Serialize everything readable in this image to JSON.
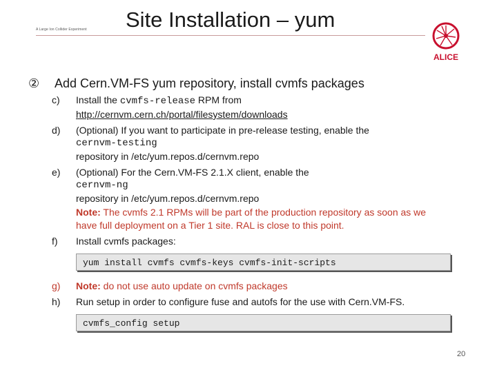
{
  "header": {
    "title": "Site Installation – yum",
    "logo_caption": "A Large Ion Collider Experiment",
    "logo_text": "ALICE"
  },
  "section": {
    "number": "②",
    "title": "Add Cern.VM-FS yum repository, install cvmfs packages"
  },
  "items": {
    "c": {
      "letter": "c)",
      "text_pre": "Install the ",
      "code": "cvmfs-release",
      "text_post": " RPM from",
      "link": "http://cernvm.cern.ch/portal/filesystem/downloads"
    },
    "d": {
      "letter": "d)",
      "line1": "(Optional) If you want to participate in pre-release testing, enable the",
      "code": "cernvm-testing",
      "line3": "repository in /etc/yum.repos.d/cernvm.repo"
    },
    "e": {
      "letter": "e)",
      "line1": "(Optional) For the Cern.VM-FS 2.1.X client, enable the",
      "code": "cernvm-ng",
      "line3": "repository in /etc/yum.repos.d/cernvm.repo",
      "note_label": "Note:",
      "note_line1": " The cvmfs 2.1 RPMs will be part of the production repository as soon as we",
      "note_line2": "have full deployment on a Tier 1 site.  RAL is close to this point."
    },
    "f": {
      "letter": "f)",
      "text": "Install cvmfs packages:",
      "command": "yum install cvmfs cvmfs-keys cvmfs-init-scripts"
    },
    "g": {
      "letter": "g)",
      "note_label": "Note:",
      "text": " do not use auto update on cvmfs packages"
    },
    "h": {
      "letter": "h)",
      "text": "Run setup in order to configure fuse and autofs for the use with Cern.VM-FS.",
      "command": "cvmfs_config setup"
    }
  },
  "page_number": "20",
  "colors": {
    "note_red": "#c0392b",
    "logo_red": "#c8102e"
  }
}
